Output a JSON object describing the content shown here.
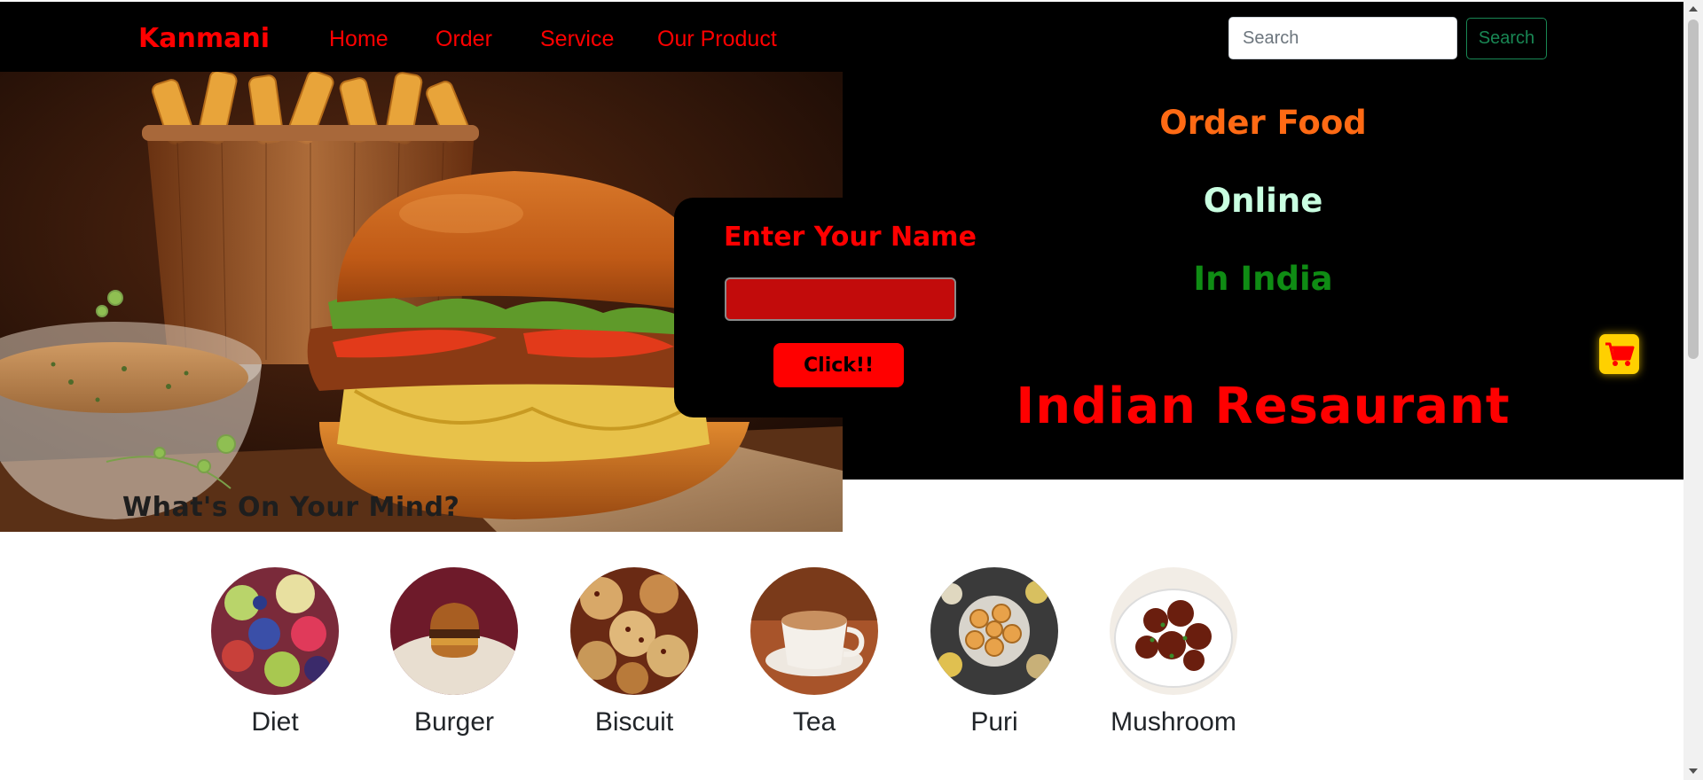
{
  "navbar": {
    "brand": "Kanmani",
    "links": [
      "Home",
      "Order",
      "Service",
      "Our Product"
    ],
    "search": {
      "placeholder": "Search",
      "button_label": "Search"
    }
  },
  "hero": {
    "caption": "What's On Your Mind?",
    "lines": [
      "Order Food",
      "Online",
      "In India",
      "Indian Resaurant"
    ]
  },
  "name_form": {
    "label": "Enter Your Name",
    "input_value": "",
    "button_label": "Click!!"
  },
  "cart": {
    "icon": "shopping-cart-icon"
  },
  "categories": [
    {
      "label": "Diet",
      "icon": "diet-image"
    },
    {
      "label": "Burger",
      "icon": "burger-image"
    },
    {
      "label": "Biscuit",
      "icon": "biscuit-image"
    },
    {
      "label": "Tea",
      "icon": "tea-image"
    },
    {
      "label": "Puri",
      "icon": "puri-image"
    },
    {
      "label": "Mushroom",
      "icon": "mushroom-image"
    }
  ],
  "colors": {
    "accent": "#ff0000",
    "navbar_bg": "#000000",
    "search_button": "#198754",
    "line_order": "#ff6a14",
    "line_online": "#c9ffe1",
    "line_india": "#0f8c14",
    "cart_bg": "#ffd000"
  }
}
